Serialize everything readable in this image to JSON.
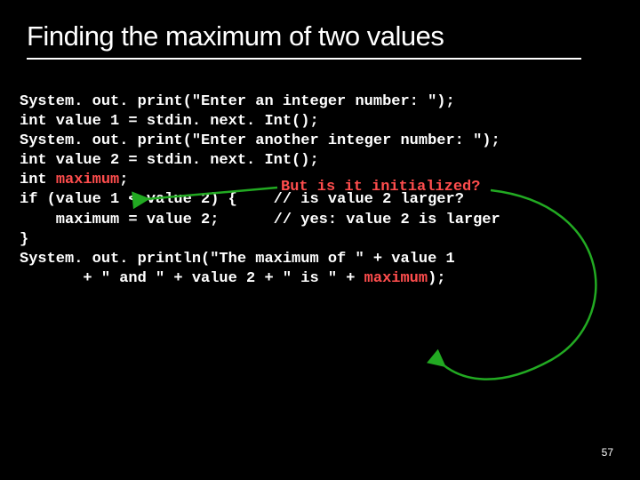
{
  "title": "Finding the maximum of two values",
  "code": {
    "l1": "System. out. print(\"Enter an integer number: \");",
    "l2": "int value 1 = stdin. next. Int();",
    "l3": "System. out. print(\"Enter another integer number: \");",
    "l4": "int value 2 = stdin. next. Int();",
    "l5": "",
    "l6a": "int ",
    "l6b": "maximum",
    "l6c": ";",
    "l7a": "if (value 1 < value 2) {    ",
    "l7b": "// is value 2 larger?",
    "l8a": "    maximum = value 2;      ",
    "l8b": "// yes: value 2 is larger",
    "l9": "}",
    "l10": "",
    "l11": "",
    "l12": "",
    "l13": "System. out. println(\"The maximum of \" + value 1",
    "l14a": "       + \" and \" + value 2 + \" is \" + ",
    "l14b": "maximum",
    "l14c": ");"
  },
  "annotation": "But is it initialized?",
  "page_number": "57",
  "colors": {
    "annotation": "#ff4d4d",
    "arrow": "#22aa22"
  }
}
